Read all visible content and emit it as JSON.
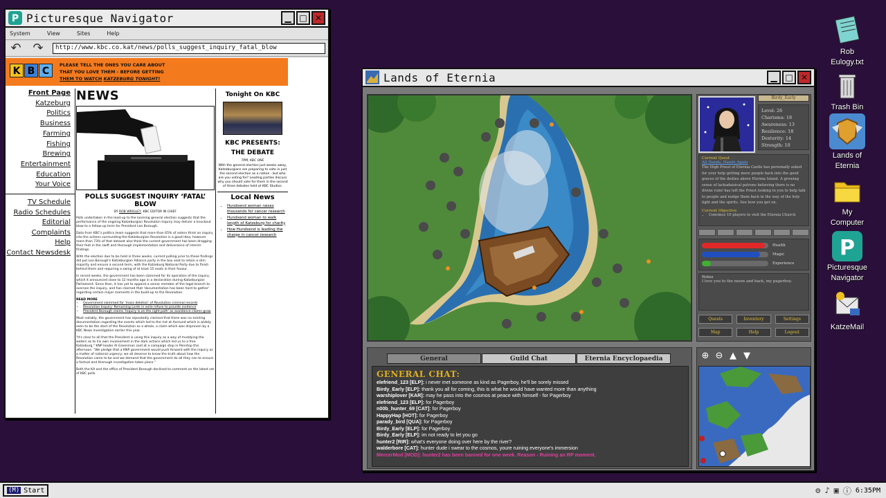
{
  "navigator": {
    "title": "Picturesque Navigator",
    "menu": [
      "System",
      "View",
      "Sites",
      "Help"
    ],
    "url": "http://www.kbc.co.kat/news/polls_suggest_inquiry_fatal_blow",
    "banner": {
      "logo": [
        "K",
        "B",
        "C"
      ],
      "line1": "PLEASE TELL THE ONES YOU CARE ABOUT",
      "line2": "THAT YOU LOVE THEM - BEFORE GETTING",
      "line3": "THEM TO WATCH",
      "line3_em": "KATZEBURG TONIGHT!"
    },
    "leftnav": [
      "Front Page",
      "Katzeburg",
      "Politics",
      "Business",
      "Farming",
      "Fishing",
      "Brewing",
      "Entertainment",
      "Education",
      "Your Voice"
    ],
    "leftnav2": [
      "TV Schedule",
      "Radio Schedules",
      "Editorial Complaints",
      "Help",
      "Contact Newsdesk"
    ],
    "article": {
      "section": "NEWS",
      "headline": "POLLS SUGGEST INQUIRY ‘FATAL’ BLOW",
      "byline_prefix": "BY",
      "byline_author": "ROB WRIGLEY",
      "byline_suffix": ", KBC EDITOR IN CHIEF",
      "p1": "Polls undertaken in the lead-up to the looming general election suggests that the performance of the ongoing Katzeburgian Revolution Inquiry may deliver a knockout blow to a follow-up term for President Leo Borough.",
      "p2": "Data from KBC's politics team suggests that more than 65% of voters think an inquiry into the actions surrounding the Katzeburgian Revolution is a good idea, however more than 73% of that dataset also think the current government has been dragging their feet in the swift and thorough implementation and deliverance of interim findings.",
      "p3": "With the election due to be held in three weeks, current polling prior to these findings did put Leo Borough's Katzeburgian Alliance party in the box seat to retain a slim majority and ensure a second term, with the Katzeburg National Party due to finish behind them and requiring a swing of at least 15 seats in their favour.",
      "p4": "In recent weeks, the government has been slammed for its operation of the inquiry, which it announced close to 12 months ago in a declaration during Katzeburgian Parliament. Since then, it has yet to appoint a senior member of the legal branch to oversee the inquiry, and has claimed that 'documentation has been hard to gather' regarding certain major moments in the build-up to the Revolution.",
      "read_more": "READ MORE",
      "links": [
        "Government slammed for 'mass deletion' of Revolution criminal records",
        "Revolution Inquiry: Remaining Lords in exile refuse to provide evidence",
        "President Borough claims 'Inquiry is on the right path' as avoidance claims grow"
      ],
      "p5": "Most notably, the government has repeatedly claimed that there was no existing documentation regarding the events which led to the riot at Axmund which is widely seen to be the start of the Revolution as a whole, a claim which was disproven by a KBC News investigation earlier this year.",
      "p6": "\"It's clear to all that the President is using this inquiry as a way of muddying the waters as to his own involvement in the dark actions which led us to a free Katzeburg,\" KNP leader Al Greenman said at a campaign stop in Penntop this afternoon. \"We pledge that a KNP government would push forward with the inquiry as a matter of national urgency; we all deserve to know the truth about how the Revolution came to be and we demand that the government do all they can to ensure a factual and thorough investigation takes place.\"",
      "p7": "Both the KA and the office of President Borough declined to comment on the latest set of KBC polls."
    },
    "right": {
      "tonight": "Tonight On KBC",
      "debate_title": "KBC PRESENTS: THE DEBATE",
      "debate_time": "7PM, KBC ONE",
      "debate_text": "With the general election just weeks away, Katzeburgians are preparing to vote in just the second election as a nation - but who are you voting for? Leading parties discuss why you should vote for them in the second of three debates held at KBC Studios.",
      "local_news": "Local News",
      "local_links": [
        "Hundsend woman raises thousands for cancer research",
        "Hundsend woman to walk length of Katzeburg for charity",
        "How Hundsend is leading the charge in cancer research"
      ]
    }
  },
  "eternia": {
    "title": "Lands of Eternia",
    "character": {
      "name": "Birdy_Early",
      "stats": [
        "Level: 26",
        "Charisma: 18",
        "Awareness: 13",
        "Resilience: 18",
        "Dexterity: 14",
        "Strength: 10"
      ]
    },
    "quest": {
      "label": "Current Quest",
      "name": "All Hands, Hands Again",
      "desc": "The High Priest of Eternia Castle has personally asked for your help getting more people back into the good graces of the deities above Eternia Island. A growing sense of lackadaisical patrons believing there is no divine ruler has left the Priest looking to you to help talk to people and nudge them back in the way of the holy light and the spirits. See how you get on.",
      "objective_label": "Current Objective",
      "objective": "Convince 10 players to visit the Eternia Church"
    },
    "bars": {
      "health": {
        "label": "Health",
        "value": 0.95,
        "color": "#e02828"
      },
      "magic": {
        "label": "Magic",
        "value": 0.88,
        "color": "#2050c0"
      },
      "experience": {
        "label": "Experience",
        "value": 0.14,
        "color": "#40b030"
      }
    },
    "notes": {
      "label": "Notes",
      "text": "I love you to the moon and back, my pagerboy."
    },
    "buttons": [
      "Quests",
      "Inventory",
      "Settings",
      "Map",
      "Help",
      "Logout"
    ],
    "chat": {
      "tabs": [
        "General",
        "Guild Chat",
        "Eternia Encyclopaedia"
      ],
      "heading": "GENERAL CHAT:",
      "lines": [
        {
          "user": "elefriend_123 [ELP]:",
          "msg": " i never met someone as kind as Pagerboy, he'll be sorely missed"
        },
        {
          "user": "Birdy_Early [ELP]:",
          "msg": " thank you all for coming, this is what he would have wanted more than anything"
        },
        {
          "user": "warshiplover [KAR]:",
          "msg": " may he pass into the cosmos at peace with himself - for Pagerboy"
        },
        {
          "user": "elefriend_123 [ELP]:",
          "msg": " for Pagerboy"
        },
        {
          "user": "n00b_hunter_69 [CAT]:",
          "msg": " for Pagerboy"
        },
        {
          "user": "HappyHap [HOT]:",
          "msg": " for Pagerboy"
        },
        {
          "user": "parady_bird [QUA]:",
          "msg": " for Pagerboy"
        },
        {
          "user": "Birdy_Early [ELP]:",
          "msg": " for Pagerboy"
        },
        {
          "user": "Birdy_Early [ELP]:",
          "msg": " im not ready to let you go"
        },
        {
          "user": "hunter2 [RIR]:",
          "msg": " what's everyone doing over here by the river?"
        },
        {
          "user": "walderbore [CAT]:",
          "msg": " hunter dude i swear to the cosmos, youre ruining everyone's immersion"
        }
      ],
      "mod_line": "MercerMod [MOD]: hunter2 has been banned for one week. Reason - Ruining an RP moment."
    },
    "map_tools": [
      "zoom-in",
      "zoom-out",
      "up",
      "down"
    ]
  },
  "desktop": {
    "icons": [
      {
        "label1": "Rob",
        "label2": "Eulogy.txt"
      },
      {
        "label1": "Trash Bin",
        "label2": ""
      },
      {
        "label1": "Lands of",
        "label2": "Eternia"
      },
      {
        "label1": "My",
        "label2": "Computer"
      },
      {
        "label1": "Picturesque",
        "label2": "Navigator"
      },
      {
        "label1": "KatzeMail",
        "label2": ""
      }
    ]
  },
  "taskbar": {
    "start_logo": "(M)",
    "start_label": "Start",
    "time": "6:35PM"
  }
}
